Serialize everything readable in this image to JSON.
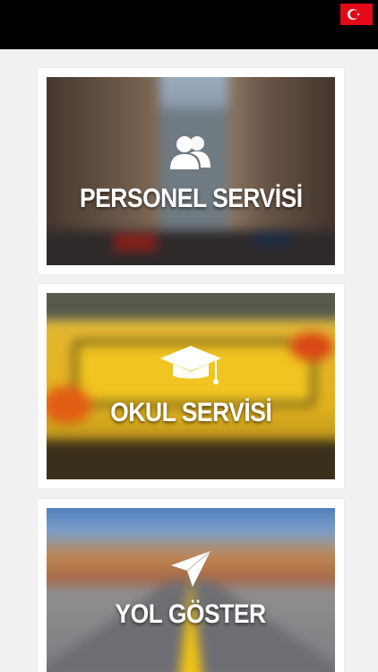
{
  "status_bar": {
    "flag_icon": "turkey-flag-icon",
    "flag_color": "#e30a17"
  },
  "menu": [
    {
      "label": "PERSONEL SERVİSİ",
      "icon": "users-icon",
      "image": "city-street-photo"
    },
    {
      "label": "OKUL SERVİSİ",
      "icon": "graduation-cap-icon",
      "image": "school-bus-photo"
    },
    {
      "label": "YOL GÖSTER",
      "icon": "navigation-arrow-icon",
      "image": "desert-road-photo"
    }
  ]
}
